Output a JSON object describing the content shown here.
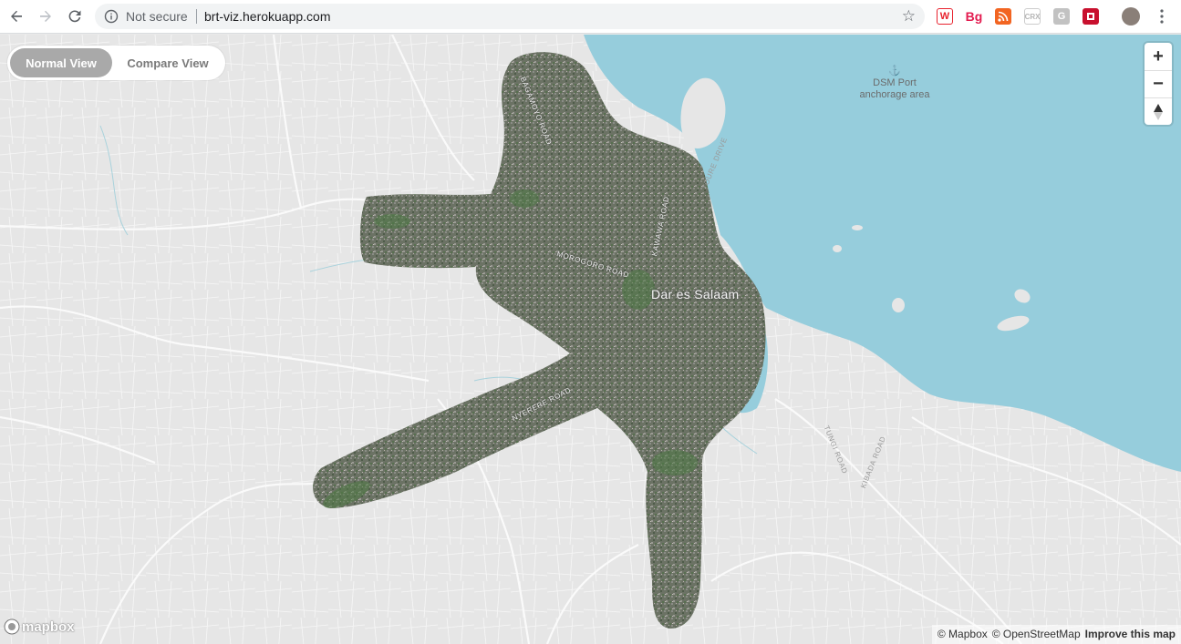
{
  "browser": {
    "security_label": "Not secure",
    "url": "brt-viz.herokuapp.com",
    "extensions": [
      {
        "name": "wikipedia-extension",
        "label": "W",
        "color": "#e8232e"
      },
      {
        "name": "bg-extension",
        "label": "Bg",
        "color": "#e31b4f"
      },
      {
        "name": "rss-extension",
        "label": "",
        "color": "#f26522"
      },
      {
        "name": "crx-extension",
        "label": "CRX",
        "color": "#c8c8c8"
      },
      {
        "name": "g-extension",
        "label": "G",
        "color": "#b8b8b8"
      },
      {
        "name": "red-extension",
        "label": "",
        "color": "#c8102e"
      }
    ]
  },
  "view_toggle": {
    "normal_label": "Normal View",
    "compare_label": "Compare View",
    "active": "normal"
  },
  "map": {
    "port_label_line1": "DSM Port",
    "port_label_line2": "anchorage area",
    "city_label": "Dar es Salaam",
    "roads": {
      "morogoro": "MOROGORO ROAD",
      "kawawa": "KAWAWA ROAD",
      "nyerere": "NYERERE ROAD",
      "toure": "TOURE DRIVE",
      "tungi": "TUNGI ROAD",
      "kibada": "KIBADA ROAD",
      "bagamoyo": "BAGAMOYO ROAD"
    },
    "water_color": "#96cddc",
    "land_color": "#e6e6e6",
    "imagery_color": "#667060"
  },
  "controls": {
    "zoom_in": "+",
    "zoom_out": "−",
    "reset_north": "▲"
  },
  "footer": {
    "logo_text": "mapbox",
    "attribution_mapbox": "© Mapbox",
    "attribution_osm": "© OpenStreetMap",
    "improve": "Improve this map"
  }
}
